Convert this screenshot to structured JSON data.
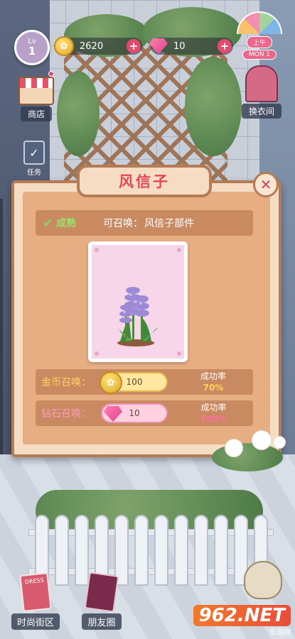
{
  "hud": {
    "level_prefix": "Lv",
    "level": "1",
    "coins": "2620",
    "gems": "10",
    "time_period": "上午",
    "time_day": "MON 1",
    "shop_label": "商店",
    "wardrobe_label": "换衣间",
    "task_label": "任务"
  },
  "modal": {
    "title": "风信子",
    "close_symbol": "✕",
    "status_label": "成熟",
    "summon_label": "可召唤：",
    "summon_value": "风信子部件",
    "coin_row": {
      "label": "金币召唤：",
      "cost": "100",
      "rate_title": "成功率",
      "rate_value": "70%"
    },
    "gem_row": {
      "label": "钻石召唤：",
      "cost": "10",
      "rate_title": "成功率",
      "rate_value": "100%"
    }
  },
  "bottom_nav": {
    "fashion_label": "时尚街区",
    "fashion_card_text": "DRESS",
    "friends_label": "朋友圈"
  },
  "watermark": {
    "main": "962.NET",
    "sub": "乐游网"
  },
  "icons": {
    "coin": "coin-icon",
    "gem": "gem-icon",
    "check": "check-icon",
    "close": "close-icon"
  },
  "colors": {
    "title_red": "#e0475a",
    "modal_frame": "#b47b56",
    "modal_fill": "#e7ad83",
    "mature_green": "#9be06a"
  }
}
